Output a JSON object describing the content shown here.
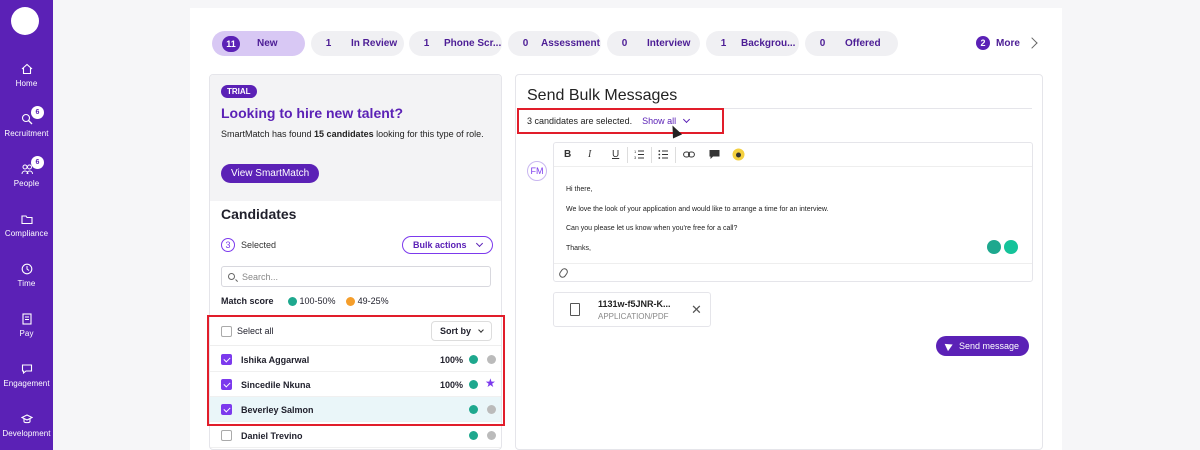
{
  "sidebar": {
    "items": [
      {
        "label": "Home",
        "icon": "home-icon",
        "badge": ""
      },
      {
        "label": "Recruitment",
        "icon": "search-people-icon",
        "badge": "6"
      },
      {
        "label": "People",
        "icon": "people-icon",
        "badge": "6"
      },
      {
        "label": "Compliance",
        "icon": "folder-icon",
        "badge": ""
      },
      {
        "label": "Time",
        "icon": "clock-icon",
        "badge": ""
      },
      {
        "label": "Pay",
        "icon": "pay-icon",
        "badge": ""
      },
      {
        "label": "Engagement",
        "icon": "chat-icon",
        "badge": ""
      },
      {
        "label": "Development",
        "icon": "graduation-cap-icon",
        "badge": ""
      }
    ]
  },
  "stages": [
    {
      "count": "11",
      "label": "New"
    },
    {
      "count": "1",
      "label": "In Review"
    },
    {
      "count": "1",
      "label": "Phone Scr..."
    },
    {
      "count": "0",
      "label": "Assessment"
    },
    {
      "count": "0",
      "label": "Interview"
    },
    {
      "count": "1",
      "label": "Backgrou..."
    },
    {
      "count": "0",
      "label": "Offered"
    }
  ],
  "more": {
    "count": "2",
    "label": "More"
  },
  "trial": {
    "tag": "TRIAL",
    "title": "Looking to hire new talent?",
    "text_prefix": "SmartMatch has found ",
    "text_bold": "15 candidates",
    "text_suffix": " looking for this type of role.",
    "button": "View SmartMatch"
  },
  "candidates": {
    "title": "Candidates",
    "selected_count": "3",
    "selected_label": "Selected",
    "bulk_actions": "Bulk actions",
    "search_placeholder": "Search...",
    "match_score_label": "Match score",
    "legend": [
      {
        "label": "100-50%",
        "color": "#1ea88e"
      },
      {
        "label": "49-25%",
        "color": "#f59e2b"
      }
    ],
    "select_all": "Select all",
    "sort_by": "Sort by",
    "rows": [
      {
        "name": "Ishika Aggarwal",
        "percent": "100%",
        "checked": true,
        "status": "minus"
      },
      {
        "name": "Sincedile Nkuna",
        "percent": "100%",
        "checked": true,
        "status": "star"
      },
      {
        "name": "Beverley Salmon",
        "percent": "",
        "checked": true,
        "status": "minus"
      },
      {
        "name": "Daniel Trevino",
        "percent": "",
        "checked": false,
        "status": "minus"
      }
    ]
  },
  "bulk_message": {
    "title": "Send Bulk Messages",
    "selected_text": "3 candidates are selected.",
    "show_all": "Show all",
    "sender_initials": "FM",
    "toolbar": [
      "B",
      "I",
      "U",
      "ordered-list-icon",
      "bullet-list-icon",
      "link-icon",
      "comment-icon",
      "bee-icon"
    ],
    "body_lines": [
      "Hi there,",
      "We love the look of your application and would like to arrange a time for an interview.",
      "Can you please let us know when you're free for a call?",
      "Thanks,"
    ],
    "attachment": {
      "name": "1131w-f5JNR-K...",
      "type": "APPLICATION/PDF"
    },
    "send_button": "Send message"
  }
}
